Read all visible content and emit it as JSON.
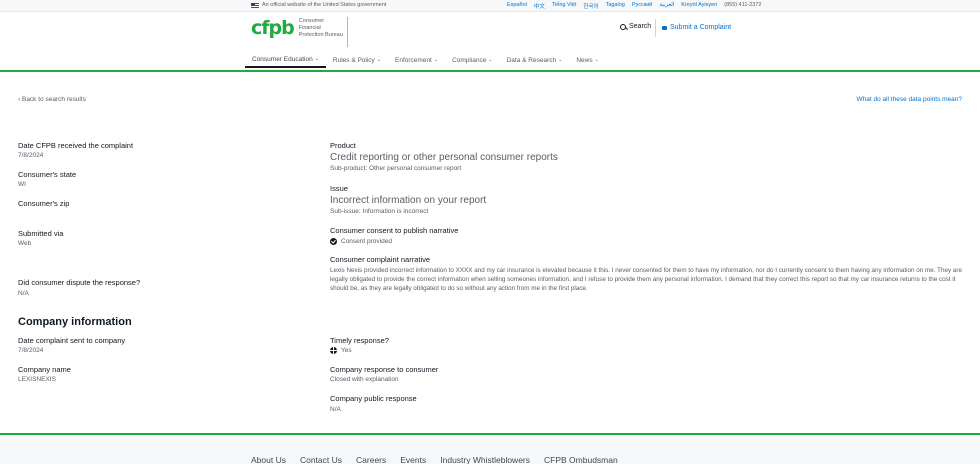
{
  "gov_banner": {
    "text": "An official website of the United States government",
    "languages": [
      "Español",
      "中文",
      "Tiếng Việt",
      "한국어",
      "Tagalog",
      "Русский",
      "العربية",
      "Kreyòl Ayisyen"
    ],
    "phone": "(855) 411-2372"
  },
  "header": {
    "logo_mark": "cfpb",
    "logo_text": "Consumer Financial Protection Bureau",
    "search_label": "Search",
    "submit_label": "Submit a Complaint"
  },
  "nav": {
    "items": [
      {
        "label": "Consumer Education",
        "active": true
      },
      {
        "label": "Rules & Policy",
        "active": false
      },
      {
        "label": "Enforcement",
        "active": false
      },
      {
        "label": "Compliance",
        "active": false
      },
      {
        "label": "Data & Research",
        "active": false
      },
      {
        "label": "News",
        "active": false
      }
    ]
  },
  "page": {
    "back_link": "Back to search results",
    "meaning_link": "What do all these data points mean?"
  },
  "left": {
    "date_received_label": "Date CFPB received the complaint",
    "date_received_value": "7/8/2024",
    "state_label": "Consumer's state",
    "state_value": "WI",
    "zip_label": "Consumer's zip",
    "submitted_label": "Submitted via",
    "submitted_value": "Web",
    "dispute_label": "Did consumer dispute the response?",
    "dispute_value": "N/A"
  },
  "right": {
    "product_label": "Product",
    "product_value": "Credit reporting or other personal consumer reports",
    "subproduct": "Sub-product: Other personal consumer report",
    "issue_label": "Issue",
    "issue_value": "Incorrect information on your report",
    "subissue": "Sub-issue: Information is incorrect",
    "consent_label": "Consumer consent to publish narrative",
    "consent_value": "Consent provided",
    "narrative_label": "Consumer complaint narrative",
    "narrative_text": "Lexis Nexis provided incorrect information to XXXX and my car insurance is elevated because it this. I never consented for them to have my information, nor do I currently consent to them having any information on me. They are legally obligated to provide the correct information when selling someones information, and I refuse to provide them any personal information. I demand that they correct this report so that my car insurance returns to the cost it should be, as they are legally obligated to do so without any action from me in the first place."
  },
  "company": {
    "heading": "Company information",
    "date_sent_label": "Date complaint sent to company",
    "date_sent_value": "7/8/2024",
    "name_label": "Company name",
    "name_value": "LEXISNEXIS",
    "timely_label": "Timely response?",
    "timely_value": "Yes",
    "response_label": "Company response to consumer",
    "response_value": "Closed with explanation",
    "public_label": "Company public response",
    "public_value": "N/A"
  },
  "footer": {
    "links": [
      "About Us",
      "Contact Us",
      "Careers",
      "Events",
      "Industry Whistleblowers",
      "CFPB Ombudsman"
    ]
  },
  "colors": {
    "brand_green": "#20aa3f",
    "link_blue": "#0072ce",
    "text_dark": "#101820"
  }
}
